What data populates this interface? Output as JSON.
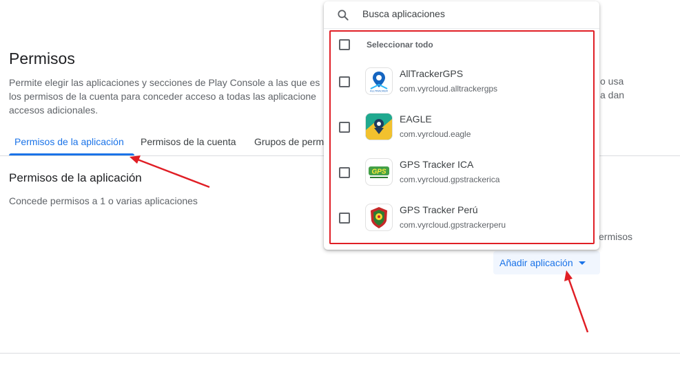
{
  "page": {
    "title": "Permisos",
    "description_lines": [
      "Permite elegir las aplicaciones y secciones de Play Console a las que es",
      "los permisos de la cuenta para conceder acceso a todas las aplicacione",
      "accesos adicionales."
    ],
    "description_right_fragments": [
      "o usa",
      "a dan"
    ]
  },
  "tabs": [
    {
      "label": "Permisos de la aplicación",
      "active": true
    },
    {
      "label": "Permisos de la cuenta",
      "active": false
    },
    {
      "label": "Grupos de perm",
      "active": false
    }
  ],
  "section": {
    "title": "Permisos de la aplicación",
    "subtitle": "Concede permisos a 1 o varias aplicaciones",
    "right_fragment": "ermisos"
  },
  "add_app_button": {
    "label": "Añadir aplicación",
    "icon": "dropdown-caret-icon"
  },
  "popup": {
    "search_placeholder": "Busca aplicaciones",
    "select_all_label": "Seleccionar todo",
    "apps": [
      {
        "name": "AllTrackerGPS",
        "package": "com.vyrcloud.alltrackergps",
        "icon": "alltracker-logo",
        "checked": false
      },
      {
        "name": "EAGLE",
        "package": "com.vyrcloud.eagle",
        "icon": "eagle-logo",
        "checked": false
      },
      {
        "name": "GPS Tracker ICA",
        "package": "com.vyrcloud.gpstrackerica",
        "icon": "gps-tracker-ica-logo",
        "checked": false
      },
      {
        "name": "GPS Tracker Perú",
        "package": "com.vyrcloud.gpstrackerperu",
        "icon": "gps-tracker-peru-logo",
        "checked": false
      }
    ]
  },
  "colors": {
    "accent": "#1a73e8",
    "annotation": "#e01e25",
    "text_primary": "#202124",
    "text_secondary": "#5f6368"
  }
}
